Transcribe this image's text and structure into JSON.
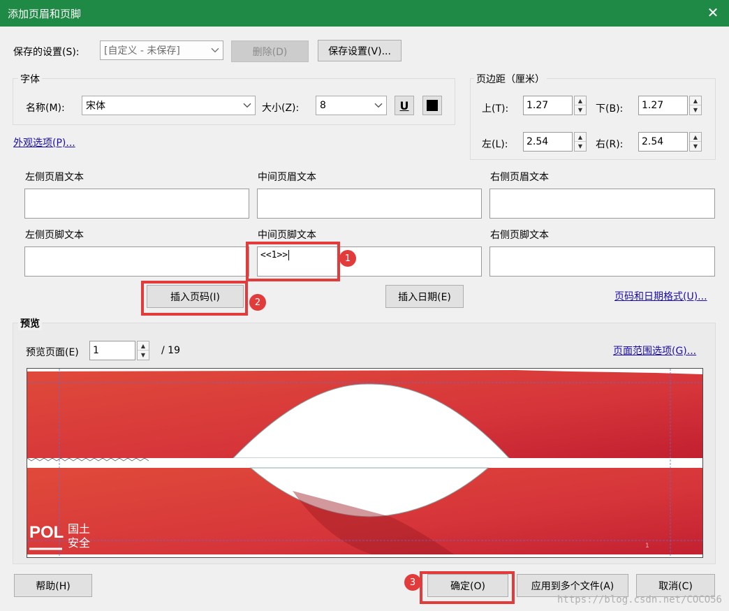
{
  "window": {
    "title": "添加页眉和页脚",
    "close_glyph": "✕"
  },
  "saved_settings": {
    "label": "保存的设置(S):",
    "value": "[自定义 - 未保存]",
    "delete_label": "删除(D)",
    "save_label": "保存设置(V)..."
  },
  "font": {
    "group_label": "字体",
    "name_label": "名称(M):",
    "name_value": "宋体",
    "size_label": "大小(Z):",
    "size_value": "8",
    "underline_glyph": "U",
    "color": "#000000"
  },
  "margins": {
    "group_label": "页边距（厘米）",
    "top_label": "上(T):",
    "top_value": "1.27",
    "bottom_label": "下(B):",
    "bottom_value": "1.27",
    "left_label": "左(L):",
    "left_value": "2.54",
    "right_label": "右(R):",
    "right_value": "2.54"
  },
  "appearance_link": "外观选项(P)...",
  "header_texts": {
    "left_label": "左侧页眉文本",
    "center_label": "中间页眉文本",
    "right_label": "右侧页眉文本",
    "left_value": "",
    "center_value": "",
    "right_value": ""
  },
  "footer_texts": {
    "left_label": "左侧页脚文本",
    "center_label": "中间页脚文本",
    "right_label": "右侧页脚文本",
    "left_value": "",
    "center_value": "<<1>>",
    "right_value": ""
  },
  "insert": {
    "page_number_label": "插入页码(I)",
    "date_label": "插入日期(E)",
    "format_link": "页码和日期格式(U)..."
  },
  "preview": {
    "group_label": "预览",
    "page_label": "预览页面(E)",
    "page_value": "1",
    "total": "/ 19",
    "range_link": "页面范围选项(G)...",
    "logo_text": "POL",
    "logo_cn_1": "国土",
    "logo_cn_2": "安全",
    "page_num_small": "1",
    "colors": {
      "red": "#d63a35",
      "dark_red": "#b8232a"
    }
  },
  "steps": {
    "step1": "1",
    "step2": "2",
    "step3": "3"
  },
  "footer_buttons": {
    "help": "帮助(H)",
    "ok": "确定(O)",
    "apply_multi": "应用到多个文件(A)",
    "cancel": "取消(C)"
  },
  "watermark": "https://blog.csdn.net/COCO56"
}
